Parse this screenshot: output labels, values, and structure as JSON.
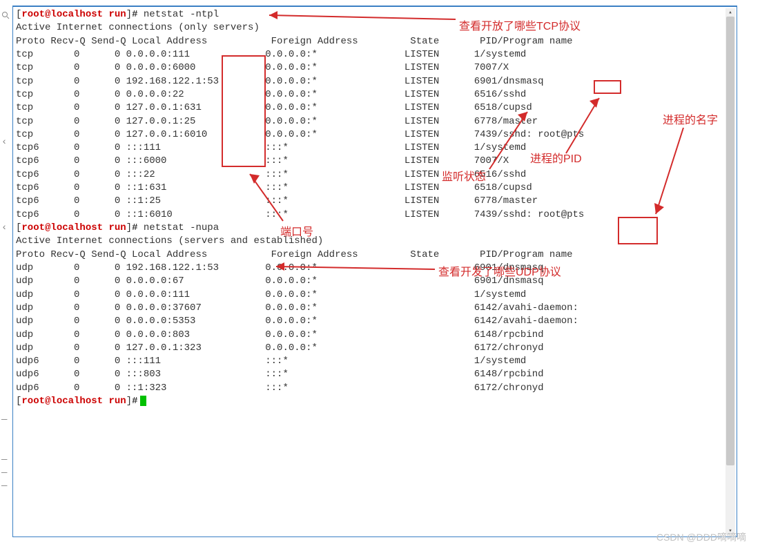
{
  "prompt": {
    "bracket_open": "[",
    "user": "root",
    "at": "@",
    "host": "localhost",
    "path": "run",
    "bracket_close": "]",
    "hash": "#"
  },
  "cmd1": "netstat -ntpl",
  "cmd2": "netstat -nupa",
  "hdr1_active": "Active Internet connections (only servers)",
  "hdr2_active": "Active Internet connections (servers and established)",
  "cols": "Proto Recv-Q Send-Q Local Address           Foreign Address         State       PID/Program name",
  "tcp": [
    {
      "p": "tcp ",
      "r": "      0",
      "s": "      0",
      "l": " 0.0.0.0:111            ",
      "f": " 0.0.0.0:*              ",
      "st": " LISTEN     ",
      "pid": " 1/systemd"
    },
    {
      "p": "tcp ",
      "r": "      0",
      "s": "      0",
      "l": " 0.0.0.0:6000           ",
      "f": " 0.0.0.0:*              ",
      "st": " LISTEN     ",
      "pid": " 7007/X"
    },
    {
      "p": "tcp ",
      "r": "      0",
      "s": "      0",
      "l": " 192.168.122.1:53       ",
      "f": " 0.0.0.0:*              ",
      "st": " LISTEN     ",
      "pid": " 6901/dnsmasq"
    },
    {
      "p": "tcp ",
      "r": "      0",
      "s": "      0",
      "l": " 0.0.0.0:22             ",
      "f": " 0.0.0.0:*              ",
      "st": " LISTEN     ",
      "pid": " 6516/sshd"
    },
    {
      "p": "tcp ",
      "r": "      0",
      "s": "      0",
      "l": " 127.0.0.1:631          ",
      "f": " 0.0.0.0:*              ",
      "st": " LISTEN     ",
      "pid": " 6518/cupsd"
    },
    {
      "p": "tcp ",
      "r": "      0",
      "s": "      0",
      "l": " 127.0.0.1:25           ",
      "f": " 0.0.0.0:*              ",
      "st": " LISTEN     ",
      "pid": " 6778/master"
    },
    {
      "p": "tcp ",
      "r": "      0",
      "s": "      0",
      "l": " 127.0.0.1:6010         ",
      "f": " 0.0.0.0:*              ",
      "st": " LISTEN     ",
      "pid": " 7439/sshd: root@pts"
    },
    {
      "p": "tcp6",
      "r": "      0",
      "s": "      0",
      "l": " :::111                 ",
      "f": " :::*                   ",
      "st": " LISTEN     ",
      "pid": " 1/systemd"
    },
    {
      "p": "tcp6",
      "r": "      0",
      "s": "      0",
      "l": " :::6000                ",
      "f": " :::*                   ",
      "st": " LISTEN     ",
      "pid": " 7007/X"
    },
    {
      "p": "tcp6",
      "r": "      0",
      "s": "      0",
      "l": " :::22                  ",
      "f": " :::*                   ",
      "st": " LISTEN     ",
      "pid": " 6516/sshd"
    },
    {
      "p": "tcp6",
      "r": "      0",
      "s": "      0",
      "l": " ::1:631                ",
      "f": " :::*                   ",
      "st": " LISTEN     ",
      "pid": " 6518/cupsd"
    },
    {
      "p": "tcp6",
      "r": "      0",
      "s": "      0",
      "l": " ::1:25                 ",
      "f": " :::*                   ",
      "st": " LISTEN     ",
      "pid": " 6778/master"
    },
    {
      "p": "tcp6",
      "r": "      0",
      "s": "      0",
      "l": " ::1:6010               ",
      "f": " :::*                   ",
      "st": " LISTEN     ",
      "pid": " 7439/sshd: root@pts"
    }
  ],
  "udp": [
    {
      "p": "udp ",
      "r": "      0",
      "s": "      0",
      "l": " 192.168.122.1:53       ",
      "f": " 0.0.0.0:*                          ",
      "pid": " 6901/dnsmasq"
    },
    {
      "p": "udp ",
      "r": "      0",
      "s": "      0",
      "l": " 0.0.0.0:67             ",
      "f": " 0.0.0.0:*                          ",
      "pid": " 6901/dnsmasq"
    },
    {
      "p": "udp ",
      "r": "      0",
      "s": "      0",
      "l": " 0.0.0.0:111            ",
      "f": " 0.0.0.0:*                          ",
      "pid": " 1/systemd"
    },
    {
      "p": "udp ",
      "r": "      0",
      "s": "      0",
      "l": " 0.0.0.0:37607          ",
      "f": " 0.0.0.0:*                          ",
      "pid": " 6142/avahi-daemon:"
    },
    {
      "p": "udp ",
      "r": "      0",
      "s": "      0",
      "l": " 0.0.0.0:5353           ",
      "f": " 0.0.0.0:*                          ",
      "pid": " 6142/avahi-daemon:"
    },
    {
      "p": "udp ",
      "r": "      0",
      "s": "      0",
      "l": " 0.0.0.0:803            ",
      "f": " 0.0.0.0:*                          ",
      "pid": " 6148/rpcbind"
    },
    {
      "p": "udp ",
      "r": "      0",
      "s": "      0",
      "l": " 127.0.0.1:323          ",
      "f": " 0.0.0.0:*                          ",
      "pid": " 6172/chronyd"
    },
    {
      "p": "udp6",
      "r": "      0",
      "s": "      0",
      "l": " :::111                 ",
      "f": " :::*                               ",
      "pid": " 1/systemd"
    },
    {
      "p": "udp6",
      "r": "      0",
      "s": "      0",
      "l": " :::803                 ",
      "f": " :::*                               ",
      "pid": " 6148/rpcbind"
    },
    {
      "p": "udp6",
      "r": "      0",
      "s": "      0",
      "l": " ::1:323                ",
      "f": " :::*                               ",
      "pid": " 6172/chronyd"
    }
  ],
  "annotations": {
    "tcp_proto": "查看开放了哪些TCP协议",
    "udp_proto": "查看开发了哪些UDP协议",
    "port": "端口号",
    "listen": "监听状态",
    "pid": "进程的PID",
    "pname": "进程的名字"
  },
  "watermark": "CSDN @DDD嘀嘀嘀"
}
